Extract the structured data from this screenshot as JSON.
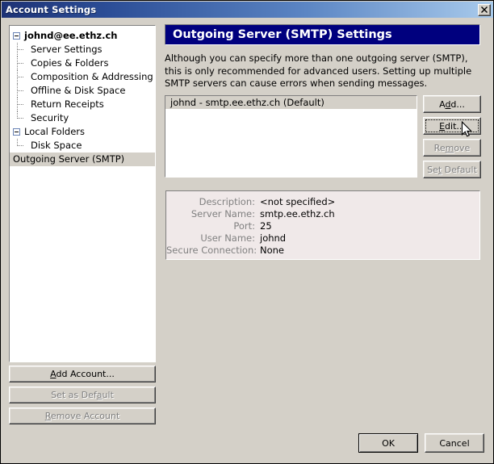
{
  "window": {
    "title": "Account Settings",
    "close_label": "✕"
  },
  "sidebar": {
    "items": [
      {
        "label": "johnd@ee.ethz.ch",
        "level": 0,
        "bold": true,
        "expander": true,
        "selected": false
      },
      {
        "label": "Server Settings",
        "level": 1,
        "bold": false,
        "expander": false,
        "selected": false
      },
      {
        "label": "Copies & Folders",
        "level": 1,
        "bold": false,
        "expander": false,
        "selected": false
      },
      {
        "label": "Composition & Addressing",
        "level": 1,
        "bold": false,
        "expander": false,
        "selected": false
      },
      {
        "label": "Offline & Disk Space",
        "level": 1,
        "bold": false,
        "expander": false,
        "selected": false
      },
      {
        "label": "Return Receipts",
        "level": 1,
        "bold": false,
        "expander": false,
        "selected": false
      },
      {
        "label": "Security",
        "level": 1,
        "bold": false,
        "expander": false,
        "selected": false,
        "lastchild": true
      },
      {
        "label": "Local Folders",
        "level": 0,
        "bold": false,
        "expander": true,
        "selected": false
      },
      {
        "label": "Disk Space",
        "level": 1,
        "bold": false,
        "expander": false,
        "selected": false,
        "lastchild": true
      },
      {
        "label": "Outgoing Server (SMTP)",
        "level": 0,
        "bold": false,
        "expander": false,
        "selected": true
      }
    ],
    "buttons": {
      "add_account": "Add Account...",
      "add_account_acc": "A",
      "set_as_default": "Set as Default",
      "set_as_default_acc": "a",
      "remove_account": "Remove Account",
      "remove_account_acc": "R"
    }
  },
  "main": {
    "header_title": "Outgoing Server (SMTP) Settings",
    "intro_text": "Although you can specify more than one outgoing server (SMTP), this is only recommended for advanced users. Setting up multiple SMTP servers can cause errors when sending messages.",
    "server_list": [
      {
        "label": "johnd - smtp.ee.ethz.ch (Default)",
        "selected": true
      }
    ],
    "list_buttons": [
      {
        "name": "add",
        "label": "Add...",
        "acc": "d",
        "enabled": true,
        "focused": false
      },
      {
        "name": "edit",
        "label": "Edit...",
        "acc": "E",
        "enabled": true,
        "focused": true
      },
      {
        "name": "remove",
        "label": "Remove",
        "acc": "m",
        "enabled": false,
        "focused": false
      },
      {
        "name": "set-default",
        "label": "Set Default",
        "acc": "t",
        "enabled": false,
        "focused": false
      }
    ],
    "details": [
      {
        "label": "Description:",
        "value": "<not specified>"
      },
      {
        "label": "Server Name:",
        "value": "smtp.ee.ethz.ch"
      },
      {
        "label": "Port:",
        "value": "25"
      },
      {
        "label": "User Name:",
        "value": "johnd"
      },
      {
        "label": "Secure Connection:",
        "value": "None"
      }
    ]
  },
  "footer": {
    "ok": "OK",
    "cancel": "Cancel"
  },
  "colors": {
    "dialog_face": "#d4d0c8",
    "title_gradient_start": "#1d3275",
    "title_gradient_end": "#a9cbec",
    "banner_blue": "#00007e",
    "details_bg": "#f0e9e9",
    "disabled_text": "#808080"
  }
}
